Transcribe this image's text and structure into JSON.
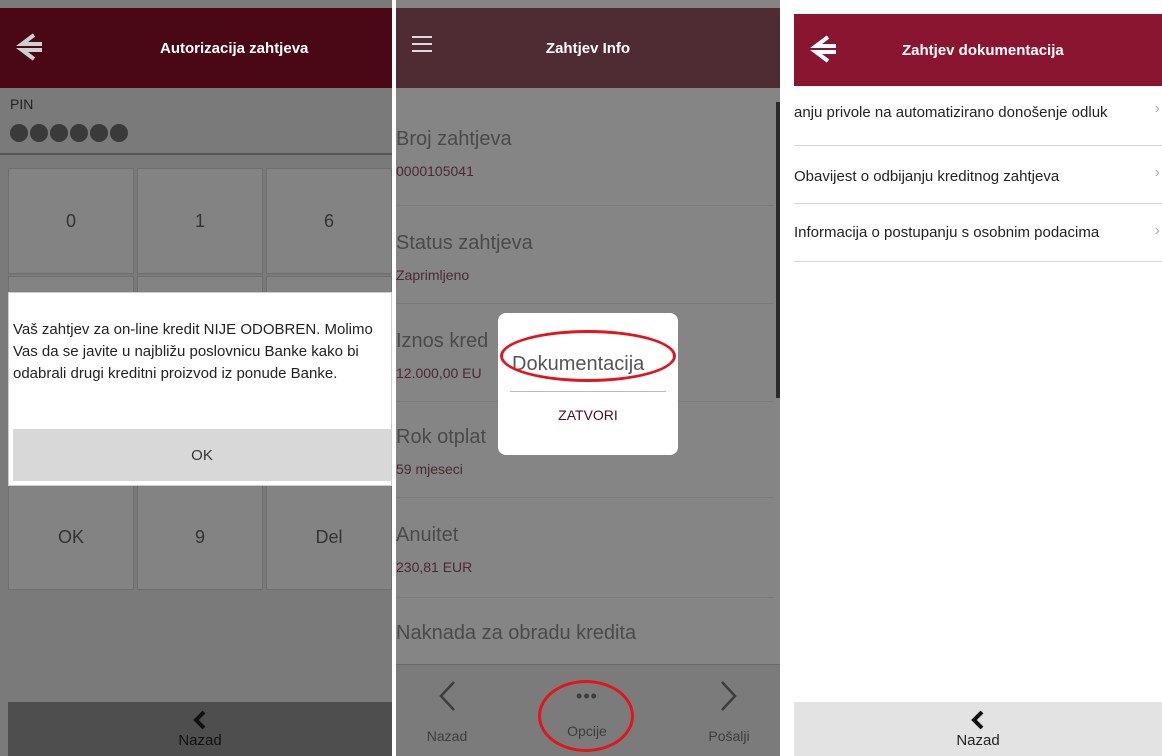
{
  "screen1": {
    "header_title": "Autorizacija zahtjeva",
    "pin_label": "PIN",
    "keys": [
      "0",
      "1",
      "6",
      "OK",
      "9",
      "Del"
    ],
    "dialog_message": "Vaš zahtjev za on-line kredit NIJE ODOBREN. Molimo Vas da se javite u najbližu poslovnicu Banke kako bi odabrali drugi kreditni proizvod iz ponude Banke.",
    "dialog_ok": "OK",
    "nav_back": "Nazad"
  },
  "screen2": {
    "header_title": "Zahtjev Info",
    "fields": [
      {
        "label": "Broj zahtjeva",
        "value": "0000105041"
      },
      {
        "label": "Status zahtjeva",
        "value": "Zaprimljeno"
      },
      {
        "label": "Iznos kred",
        "value": "12.000,00 EU"
      },
      {
        "label": "Rok otplat",
        "value": "59 mjeseci"
      },
      {
        "label": "Anuitet",
        "value": "230,81 EUR"
      },
      {
        "label": "Naknada za obradu kredita",
        "value": ""
      }
    ],
    "dialog_title": "Dokumentacija",
    "dialog_close": "ZATVORI",
    "nav_back": "Nazad",
    "nav_options": "Opcije",
    "nav_send": "Pošalji"
  },
  "screen3": {
    "header_title": "Zahtjev dokumentacija",
    "documents": [
      "anju privole na automatizirano donošenje odluk",
      "Obavijest o odbijanju kreditnog zahtjeva",
      "Informacija o postupanju s osobnim podacima"
    ],
    "nav_back": "Nazad"
  },
  "colors": {
    "brand": "#8a1530",
    "highlight_ring": "#e0161e"
  }
}
